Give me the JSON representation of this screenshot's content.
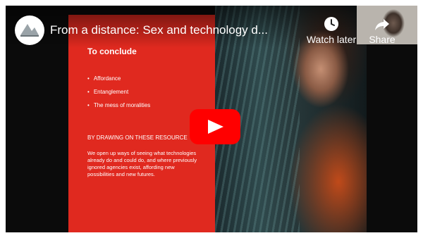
{
  "video": {
    "title": "From a distance: Sex and technology d...",
    "channel_logo": "channel-logo",
    "actions": {
      "watch_later": {
        "label": "Watch later",
        "icon": "clock-icon"
      },
      "share": {
        "label": "Share",
        "icon": "share-arrow-icon"
      }
    },
    "play_icon": "play-icon"
  },
  "slide": {
    "title": "To conclude",
    "bullets": [
      "Affordance",
      "Entanglement",
      "The mess of moralities"
    ],
    "subheading": "BY DRAWING ON THESE RESOURCE",
    "body": "We open up ways of seeing what technologies already do and could do, and where previously ignored agencies exist, affording new possibilities and new futures."
  },
  "colors": {
    "slide_red": "#e0291f",
    "play_red": "#ff0000",
    "background": "#0b0b0b"
  }
}
